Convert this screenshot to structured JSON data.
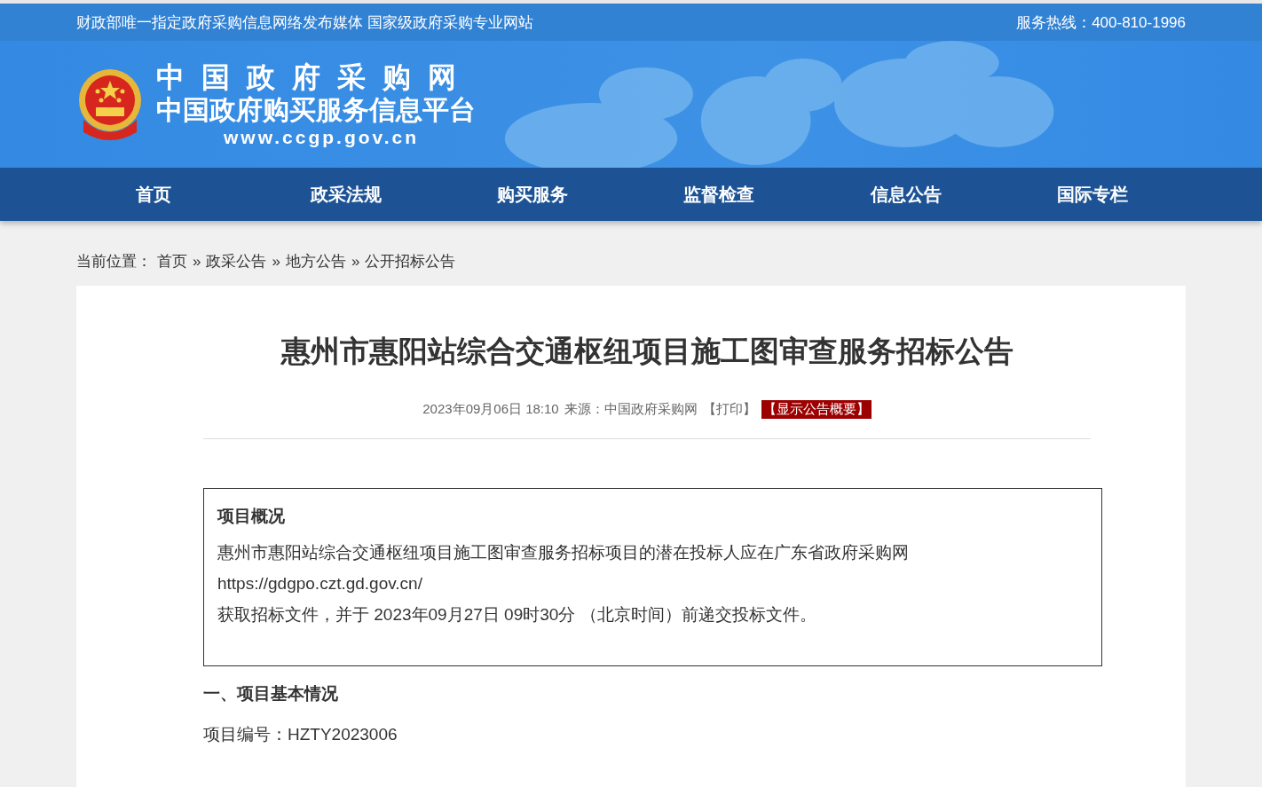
{
  "top_bar": {
    "slogan": "财政部唯一指定政府采购信息网络发布媒体 国家级政府采购专业网站",
    "hotline": "服务热线：400-810-1996"
  },
  "logo": {
    "title": "中国政府采购网",
    "subtitle": "中国政府购买服务信息平台",
    "url": "www.ccgp.gov.cn"
  },
  "nav": [
    {
      "label": "首页"
    },
    {
      "label": "政采法规"
    },
    {
      "label": "购买服务"
    },
    {
      "label": "监督检查"
    },
    {
      "label": "信息公告"
    },
    {
      "label": "国际专栏"
    }
  ],
  "breadcrumb": {
    "label": "当前位置：",
    "separator": "»",
    "items": [
      "首页",
      "政采公告",
      "地方公告",
      "公开招标公告"
    ]
  },
  "article": {
    "title": "惠州市惠阳站综合交通枢纽项目施工图审查服务招标公告",
    "date": "2023年09月06日 18:10",
    "source": "来源：中国政府采购网",
    "print": "【打印】",
    "summary_button": "【显示公告概要】",
    "overview": {
      "heading": "项目概况",
      "lines": [
        "惠州市惠阳站综合交通枢纽项目施工图审查服务招标项目的潜在投标人应在广东省政府采购网",
        "https://gdgpo.czt.gd.gov.cn/",
        "获取招标文件，并于 2023年09月27日 09时30分 （北京时间）前递交投标文件。"
      ]
    },
    "section_heading": "一、项目基本情况",
    "fields": [
      "项目编号：HZTY2023006"
    ]
  }
}
